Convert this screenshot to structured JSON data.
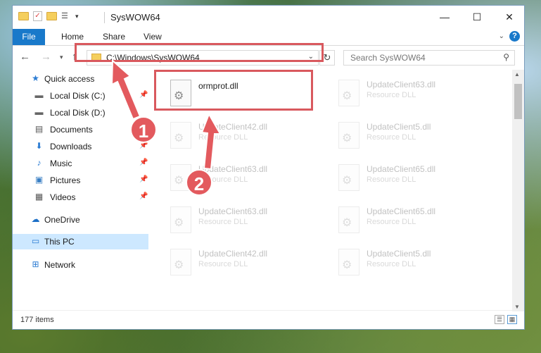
{
  "window": {
    "title": "SysWOW64",
    "controls": {
      "minimize": "—",
      "maximize": "☐",
      "close": "✕"
    }
  },
  "ribbon": {
    "tabs": [
      "File",
      "Home",
      "Share",
      "View"
    ],
    "help": "?"
  },
  "navigation": {
    "address": "C:\\Windows\\SysWOW64",
    "search_placeholder": "Search SysWOW64"
  },
  "sidebar": {
    "items": [
      {
        "label": "Quick access",
        "icon": "star-icon",
        "pinned": false
      },
      {
        "label": "Local Disk (C:)",
        "icon": "drive-icon",
        "pinned": true
      },
      {
        "label": "Local Disk (D:)",
        "icon": "drive-icon",
        "pinned": false
      },
      {
        "label": "Documents",
        "icon": "documents-icon",
        "pinned": true
      },
      {
        "label": "Downloads",
        "icon": "download-icon",
        "pinned": true
      },
      {
        "label": "Music",
        "icon": "music-icon",
        "pinned": true
      },
      {
        "label": "Pictures",
        "icon": "pictures-icon",
        "pinned": true
      },
      {
        "label": "Videos",
        "icon": "videos-icon",
        "pinned": true
      },
      {
        "label": "OneDrive",
        "icon": "cloud-icon",
        "pinned": false
      },
      {
        "label": "This PC",
        "icon": "pc-icon",
        "pinned": false,
        "selected": true
      },
      {
        "label": "Network",
        "icon": "network-icon",
        "pinned": false
      }
    ]
  },
  "files": [
    {
      "name": "ormprot.dll",
      "type": ""
    },
    {
      "name": "UpdateClient63.dll",
      "type": "Resource DLL"
    },
    {
      "name": "UpdateClient42.dll",
      "type": "Resource DLL"
    },
    {
      "name": "UpdateClient5.dll",
      "type": "Resource DLL"
    },
    {
      "name": "UpdateClient63.dll",
      "type": "Resource DLL"
    },
    {
      "name": "UpdateClient65.dll",
      "type": "Resource DLL"
    },
    {
      "name": "UpdateClient63.dll",
      "type": "Resource DLL"
    },
    {
      "name": "UpdateClient65.dll",
      "type": "Resource DLL"
    },
    {
      "name": "UpdateClient42.dll",
      "type": "Resource DLL"
    },
    {
      "name": "UpdateClient5.dll",
      "type": "Resource DLL"
    }
  ],
  "status": {
    "item_count": "177 items"
  },
  "annotations": {
    "callout_1": "1",
    "callout_2": "2",
    "accent_color": "#e35a5e"
  }
}
